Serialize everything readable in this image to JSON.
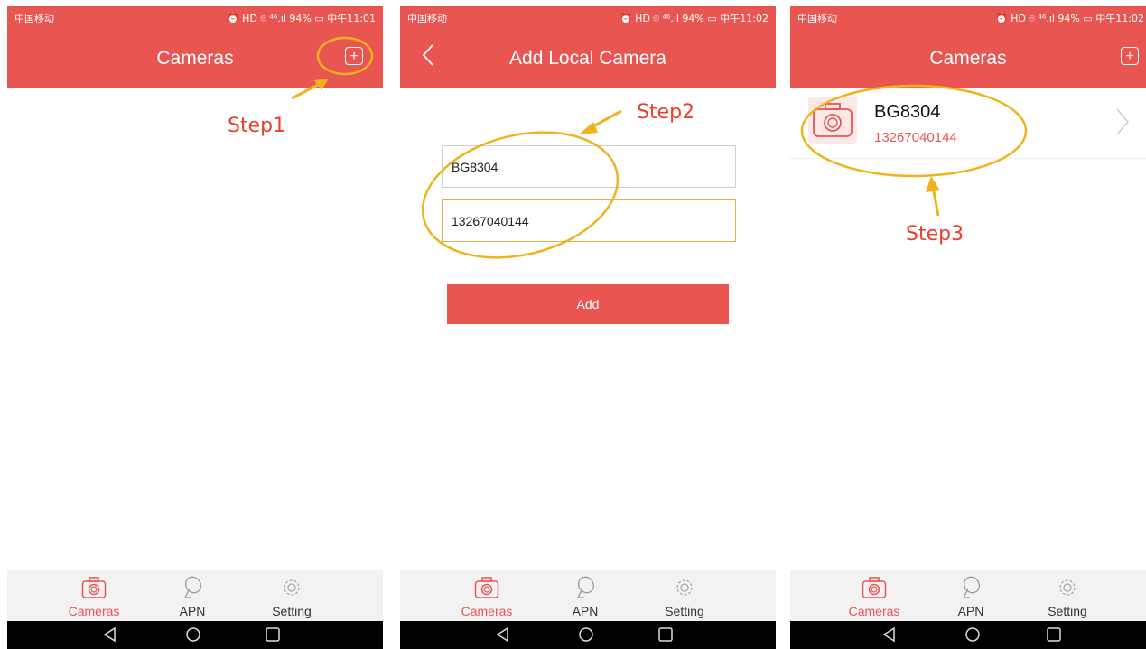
{
  "status": {
    "carrier": "中国移动",
    "icons": "⏰ HD ⌾ ⁴⁶.ıl 94%",
    "battery_icon": "battery-icon",
    "time1": "中午11:01",
    "time2": "中午11:02",
    "time3": "中午11:02"
  },
  "screens": {
    "s1": {
      "title": "Cameras"
    },
    "s2": {
      "title": "Add Local Camera",
      "name_value": "BG8304",
      "number_value": "13267040144",
      "add_label": "Add"
    },
    "s3": {
      "title": "Cameras",
      "camera_name": "BG8304",
      "camera_number": "13267040144"
    }
  },
  "tabs": {
    "cameras": "Cameras",
    "apn": "APN",
    "setting": "Setting"
  },
  "annotations": {
    "step1": "Step1",
    "step2": "Step2",
    "step3": "Step3"
  },
  "colors": {
    "accent": "#e95551",
    "annotation": "#f0b31c",
    "step_text": "#e8412f"
  }
}
